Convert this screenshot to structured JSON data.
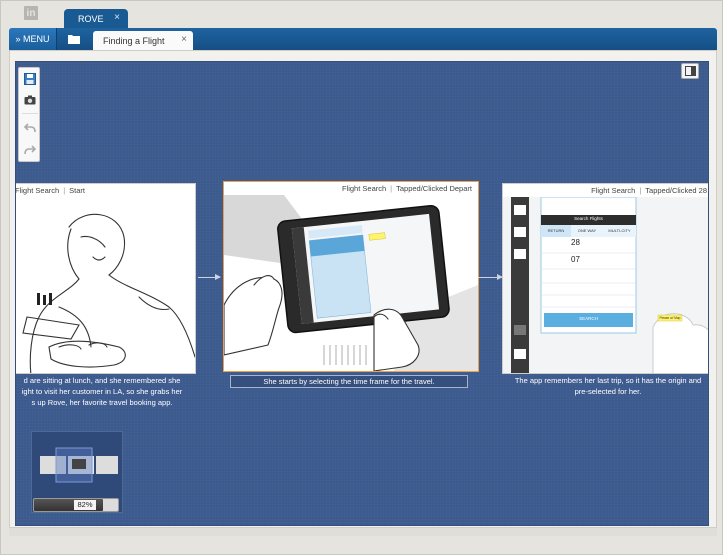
{
  "app": {
    "logo": "in",
    "doc_tab": {
      "label": "ROVE",
      "close": "×"
    },
    "menu_label": "» MENU",
    "sub_tab": {
      "label": "Finding a Flight",
      "close": "×"
    }
  },
  "storyboard": {
    "frames": [
      {
        "breadcrumb_root": "Flight Search",
        "breadcrumb_leaf": "Start",
        "caption_lines": [
          "d are sitting at lunch, and she remembered she",
          "ight to visit her customer in LA, so she grabs her",
          "s up Rove, her favorite travel booking app."
        ]
      },
      {
        "breadcrumb_root": "Flight Search",
        "breadcrumb_leaf": "Tapped/Clicked Depart",
        "caption_lines": [
          "She starts by selecting the time frame for the travel."
        ]
      },
      {
        "breadcrumb_root": "Flight Search",
        "breadcrumb_leaf": "Tapped/Clicked 28",
        "caption_lines": [
          "The app remembers her last trip, so it has the origin and",
          "pre-selected for her."
        ],
        "app_screen": {
          "panel_title": "Search Flights",
          "tabs": [
            "RETURN",
            "ONE WAY",
            "MULTI-CITY"
          ],
          "depart_day": "28",
          "return_day": "07",
          "search_button": "SEARCH",
          "sticky_note": "Please w/ Map"
        }
      }
    ]
  },
  "zoom": {
    "label": "82%",
    "value": 0.82
  },
  "colors": {
    "canvas": "#3d5a8e",
    "accent": "#1a5a93",
    "selection": "#f0a040"
  }
}
